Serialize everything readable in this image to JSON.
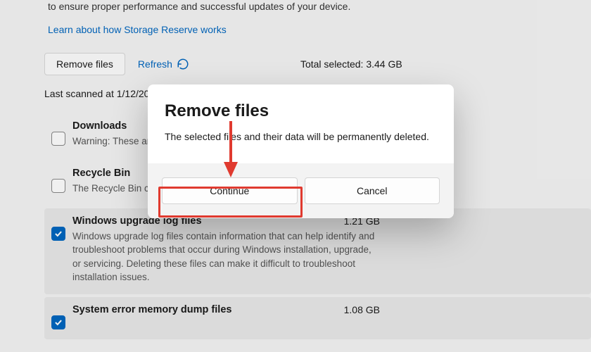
{
  "intro": {
    "line": "to ensure proper performance and successful updates of your device.",
    "learn_link": "Learn about how Storage Reserve works"
  },
  "toolbar": {
    "remove_label": "Remove files",
    "refresh_label": "Refresh",
    "total_prefix": "Total selected: ",
    "total_value": "3.44 GB"
  },
  "last_scanned": "Last scanned at 1/12/20",
  "items": [
    {
      "title": "Downloads",
      "desc": "Warning: These are this if you'd like to Storage Sense co",
      "size": "",
      "checked": false,
      "selected": false
    },
    {
      "title": "Recycle Bin",
      "desc": "The Recycle Bin co computer. These empty the Recycle",
      "size": "",
      "checked": false,
      "selected": false
    },
    {
      "title": "Windows upgrade log files",
      "desc": "Windows upgrade log files contain information that can help identify and troubleshoot problems that occur during Windows installation, upgrade, or servicing.  Deleting these files can make it difficult to troubleshoot installation issues.",
      "size": "1.21 GB",
      "checked": true,
      "selected": true
    },
    {
      "title": "System error memory dump files",
      "desc": "",
      "size": "1.08 GB",
      "checked": true,
      "selected": true
    }
  ],
  "modal": {
    "title": "Remove files",
    "text": "The selected files and their data will be permanently deleted.",
    "continue_label": "Continue",
    "cancel_label": "Cancel"
  },
  "annotation": {
    "arrow_color": "#e03a2f"
  }
}
